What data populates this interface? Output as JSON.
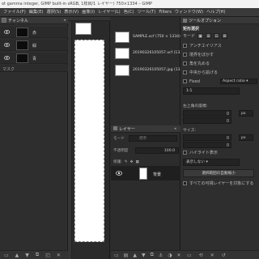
{
  "window": {
    "title": "ot gamma integer, GIMP built-in sRGB, 1枚目/1 レイヤー) 750×1334 – GIMP"
  },
  "menubar": {
    "items": [
      "ファイル(F)",
      "編集(E)",
      "選択(S)",
      "表示(V)",
      "画像(I)",
      "レイヤー(L)",
      "色(C)",
      "ツール(T)",
      "Filters",
      "ウィンドウ(W)",
      "ヘルプ(H)"
    ]
  },
  "channels": {
    "tab_label": "チャンネル",
    "rows": [
      {
        "label": "赤"
      },
      {
        "label": "緑"
      },
      {
        "label": "青"
      }
    ],
    "footer_label": "マスク"
  },
  "images": {
    "items": [
      {
        "label": "SAMPLE.xcf (750 × 1334)"
      },
      {
        "label": "20190326105057.xcf (1334"
      },
      {
        "label": "20190326105057.jpg (1334"
      }
    ]
  },
  "layers": {
    "tab_label": "レイヤー",
    "mode_label": "モード",
    "mode_value": "標準",
    "opacity_label": "不透明度",
    "opacity_value": "100.0",
    "lock_label": "保護:",
    "layer_name": "背景"
  },
  "tool_options": {
    "tab_label": "ツールオプション",
    "section_title": "矩形選択",
    "mode_label": "モード",
    "antialias_label": "アンチエイリアス",
    "feather_label": "境界をぼかす",
    "rounded_label": "角を丸める",
    "expand_label": "中央から拡げる",
    "fixed_label": "Fixed",
    "fixed_value": "Aspect ratio",
    "ratio_value": "1:1",
    "position_label": "左上角の座標:",
    "position_unit": "px",
    "position_x": "0",
    "position_y": "0",
    "size_label": "サイズ:",
    "size_unit": "px",
    "size_w": "0",
    "size_h": "0",
    "highlight_label": "ハイライト表示",
    "guide_value": "表示しない",
    "auto_shrink_label": "選択範囲の自動縮小",
    "merged_label": "すべての可視レイヤーを対象にする"
  }
}
